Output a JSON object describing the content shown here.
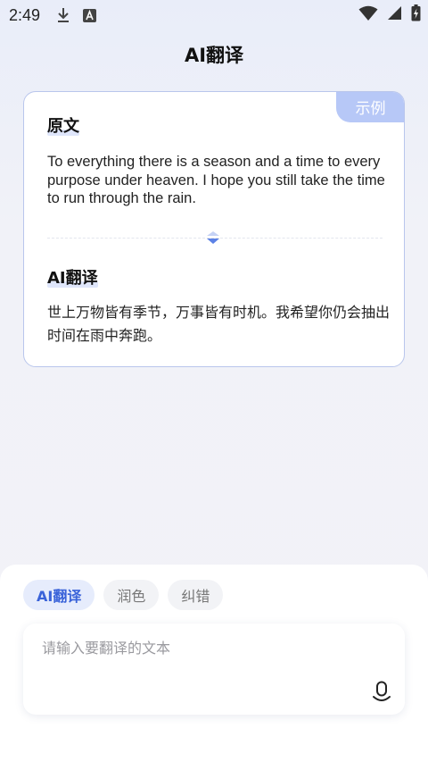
{
  "status_bar": {
    "time": "2:49",
    "icons": [
      "download-icon",
      "a-notification-icon",
      "wifi-icon",
      "cell-signal-icon",
      "battery-charging-icon"
    ]
  },
  "header": {
    "title": "AI翻译"
  },
  "example_card": {
    "tag": "示例",
    "source_title": "原文",
    "source_text": "To everything there is a season and a time to every purpose under heaven. I hope you still take the time to run through the rain.",
    "result_title": "AI翻译",
    "result_text": "世上万物皆有季节，万事皆有时机。我希望你仍会抽出时间在雨中奔跑。"
  },
  "bottom_panel": {
    "tabs": [
      {
        "label": "AI翻译",
        "active": true
      },
      {
        "label": "润色",
        "active": false
      },
      {
        "label": "纠错",
        "active": false
      }
    ],
    "input": {
      "placeholder": "请输入要翻译的文本",
      "value": ""
    }
  },
  "colors": {
    "accent": "#3a63d9",
    "tag_bg": "#b7c8f7",
    "card_border": "#b9c6ec",
    "tab_active_bg": "#e6ecfc"
  }
}
